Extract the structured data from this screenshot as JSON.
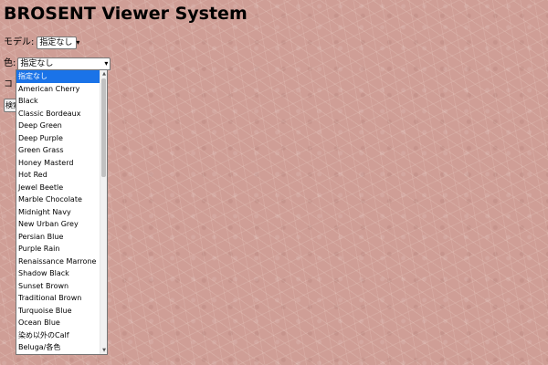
{
  "page": {
    "title": "BROSENT Viewer System",
    "background_color": "#cf9e96"
  },
  "form": {
    "model_label": "モデル:",
    "model_value": "指定なし",
    "color_label": "色:",
    "color_value": "指定なし",
    "c_label_partial": "コ",
    "search_button_partial": "検索"
  },
  "dropdown": {
    "selected_index": 0,
    "selected_color": "#1a73e8",
    "options": [
      "指定なし",
      "American Cherry",
      "Black",
      "Classic Bordeaux",
      "Deep Green",
      "Deep Purple",
      "Green Grass",
      "Honey Masterd",
      "Hot Red",
      "Jewel Beetle",
      "Marble Chocolate",
      "Midnight Navy",
      "New Urban Grey",
      "Persian Blue",
      "Purple Rain",
      "Renaissance Marrone",
      "Shadow Black",
      "Sunset Brown",
      "Traditional Brown",
      "Turquoise Blue",
      "Ocean Blue",
      "染め以外のCalf",
      "Beluga/各色"
    ]
  }
}
